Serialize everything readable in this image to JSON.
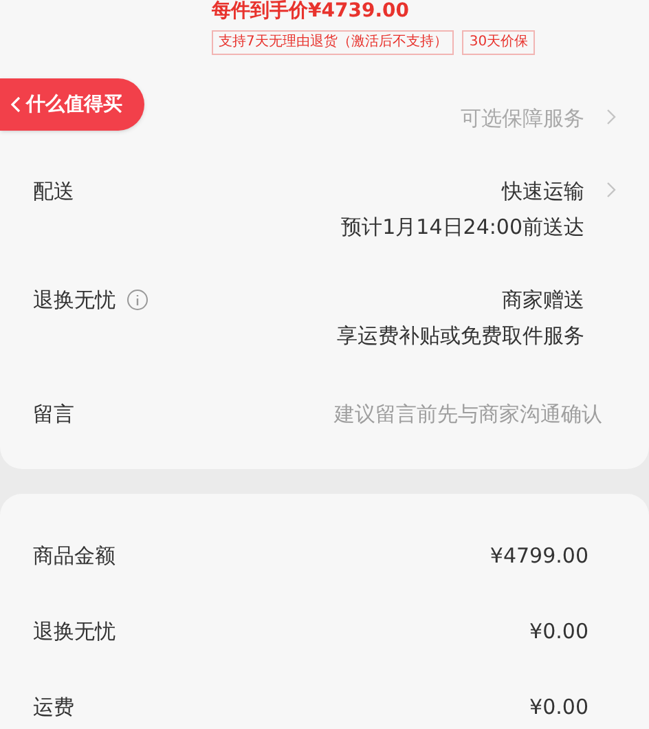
{
  "price_line": "每件到手价¥4739.00",
  "tags": [
    "支持7天无理由退货（激活后不支持）",
    "30天价保"
  ],
  "back_pill": {
    "label": "什么值得买"
  },
  "rows": [
    {
      "kind": "link",
      "label": "",
      "value": "可选保障服务",
      "muted": true
    },
    {
      "kind": "link",
      "label": "配送",
      "value": "快速运输",
      "sub": "预计1月14日24:00前送达",
      "muted": false
    },
    {
      "kind": "info",
      "label": "退换无忧",
      "value": "商家赠送",
      "sub": "享运费补贴或免费取件服务",
      "muted": false
    },
    {
      "kind": "input",
      "label": "留言",
      "placeholder": "建议留言前先与商家沟通确认"
    }
  ],
  "summary": [
    {
      "label": "商品金额",
      "value": "¥4799.00"
    },
    {
      "label": "退换无忧",
      "value": "¥0.00"
    },
    {
      "label": "运费",
      "value": "¥0.00"
    }
  ]
}
